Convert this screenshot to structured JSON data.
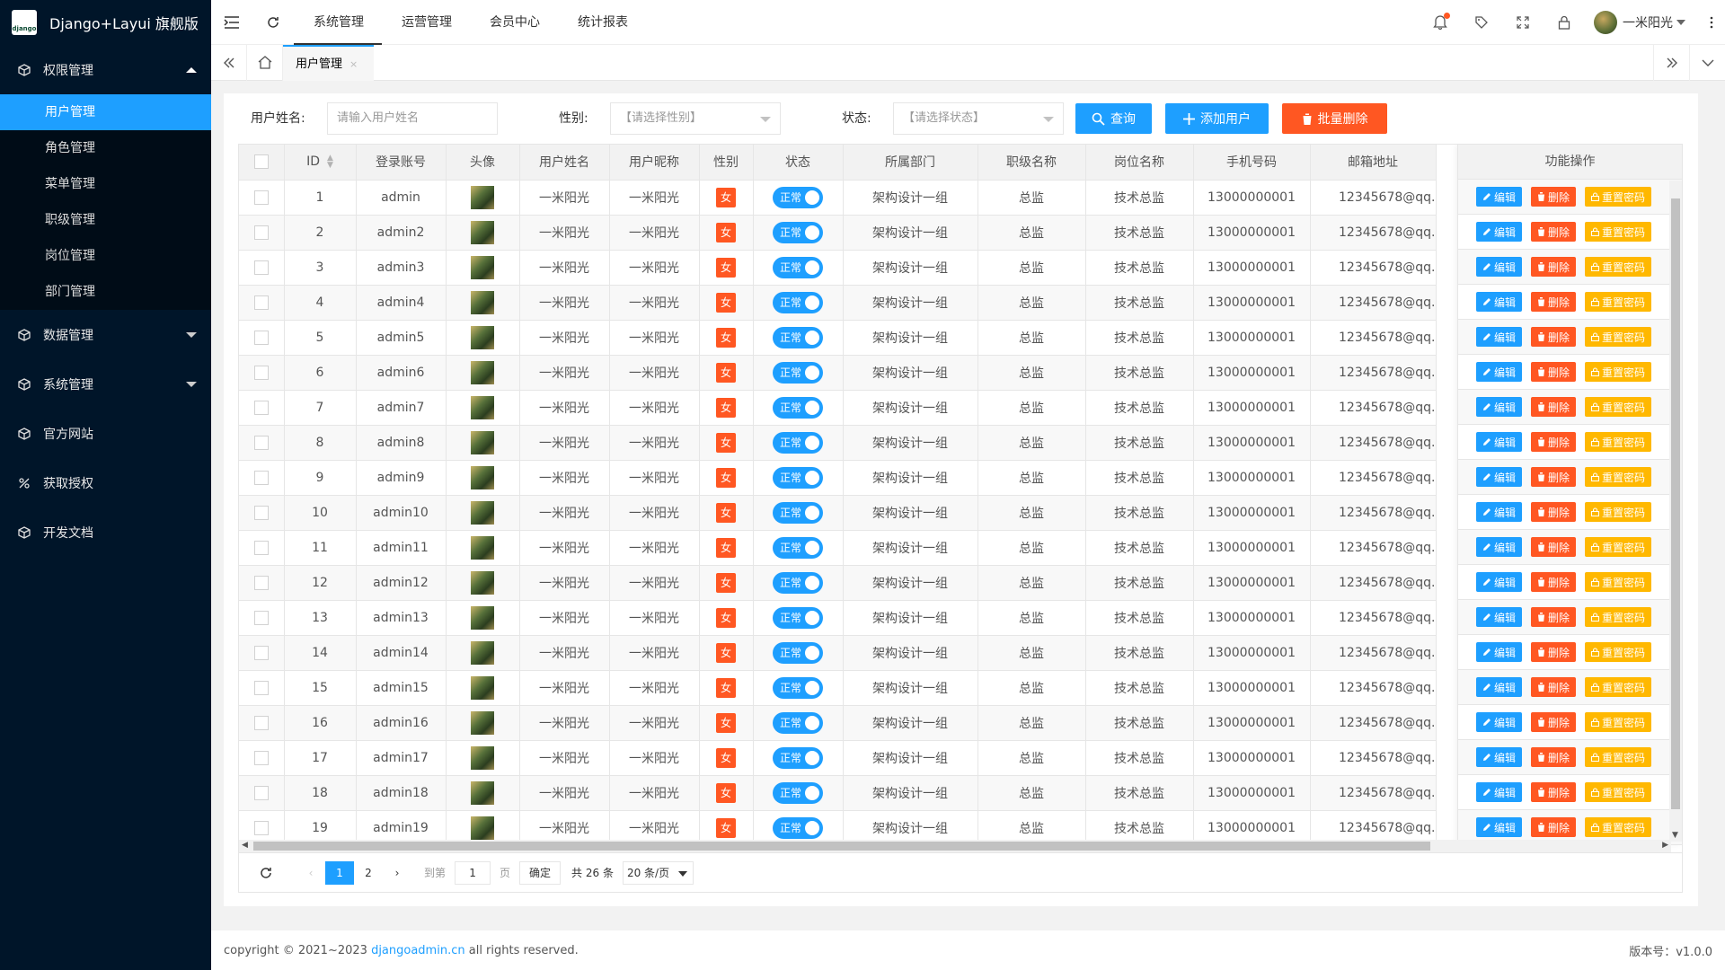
{
  "app": {
    "title": "Django+Layui 旗舰版",
    "logo_text": "django"
  },
  "sidebar": {
    "groups": [
      {
        "label": "权限管理",
        "icon": "cube-icon",
        "expanded": true,
        "items": [
          "用户管理",
          "角色管理",
          "菜单管理",
          "职级管理",
          "岗位管理",
          "部门管理"
        ]
      },
      {
        "label": "数据管理",
        "icon": "cube-icon",
        "expanded": false
      },
      {
        "label": "系统管理",
        "icon": "cube-icon",
        "expanded": false
      },
      {
        "label": "官方网站",
        "icon": "cube-icon"
      },
      {
        "label": "获取授权",
        "icon": "percent-icon"
      },
      {
        "label": "开发文档",
        "icon": "cube-icon"
      }
    ],
    "active_item": "用户管理"
  },
  "header": {
    "menus": [
      "系统管理",
      "运营管理",
      "会员中心",
      "统计报表"
    ],
    "active_menu": "系统管理",
    "user_name": "一米阳光"
  },
  "tabs": {
    "current": "用户管理",
    "close": "×"
  },
  "search": {
    "name_label": "用户姓名:",
    "name_placeholder": "请输入用户姓名",
    "gender_label": "性别:",
    "gender_placeholder": "【请选择性别】",
    "status_label": "状态:",
    "status_placeholder": "【请选择状态】",
    "query_btn": "查询",
    "add_btn": "添加用户",
    "batch_delete_btn": "批量删除"
  },
  "table": {
    "headers": [
      "ID",
      "登录账号",
      "头像",
      "用户姓名",
      "用户昵称",
      "性别",
      "状态",
      "所属部门",
      "职级名称",
      "岗位名称",
      "手机号码",
      "邮箱地址"
    ],
    "ops_header": "功能操作",
    "ops": {
      "edit": "编辑",
      "delete": "删除",
      "reset": "重置密码"
    },
    "rows": [
      {
        "id": "1",
        "account": "admin",
        "realname": "一米阳光",
        "nickname": "一米阳光",
        "gender": "女",
        "status": "正常",
        "dept": "架构设计一组",
        "level": "总监",
        "post": "技术总监",
        "mobile": "13000000001",
        "email": "12345678@qq."
      },
      {
        "id": "2",
        "account": "admin2",
        "realname": "一米阳光",
        "nickname": "一米阳光",
        "gender": "女",
        "status": "正常",
        "dept": "架构设计一组",
        "level": "总监",
        "post": "技术总监",
        "mobile": "13000000001",
        "email": "12345678@qq."
      },
      {
        "id": "3",
        "account": "admin3",
        "realname": "一米阳光",
        "nickname": "一米阳光",
        "gender": "女",
        "status": "正常",
        "dept": "架构设计一组",
        "level": "总监",
        "post": "技术总监",
        "mobile": "13000000001",
        "email": "12345678@qq."
      },
      {
        "id": "4",
        "account": "admin4",
        "realname": "一米阳光",
        "nickname": "一米阳光",
        "gender": "女",
        "status": "正常",
        "dept": "架构设计一组",
        "level": "总监",
        "post": "技术总监",
        "mobile": "13000000001",
        "email": "12345678@qq."
      },
      {
        "id": "5",
        "account": "admin5",
        "realname": "一米阳光",
        "nickname": "一米阳光",
        "gender": "女",
        "status": "正常",
        "dept": "架构设计一组",
        "level": "总监",
        "post": "技术总监",
        "mobile": "13000000001",
        "email": "12345678@qq."
      },
      {
        "id": "6",
        "account": "admin6",
        "realname": "一米阳光",
        "nickname": "一米阳光",
        "gender": "女",
        "status": "正常",
        "dept": "架构设计一组",
        "level": "总监",
        "post": "技术总监",
        "mobile": "13000000001",
        "email": "12345678@qq."
      },
      {
        "id": "7",
        "account": "admin7",
        "realname": "一米阳光",
        "nickname": "一米阳光",
        "gender": "女",
        "status": "正常",
        "dept": "架构设计一组",
        "level": "总监",
        "post": "技术总监",
        "mobile": "13000000001",
        "email": "12345678@qq."
      },
      {
        "id": "8",
        "account": "admin8",
        "realname": "一米阳光",
        "nickname": "一米阳光",
        "gender": "女",
        "status": "正常",
        "dept": "架构设计一组",
        "level": "总监",
        "post": "技术总监",
        "mobile": "13000000001",
        "email": "12345678@qq."
      },
      {
        "id": "9",
        "account": "admin9",
        "realname": "一米阳光",
        "nickname": "一米阳光",
        "gender": "女",
        "status": "正常",
        "dept": "架构设计一组",
        "level": "总监",
        "post": "技术总监",
        "mobile": "13000000001",
        "email": "12345678@qq."
      },
      {
        "id": "10",
        "account": "admin10",
        "realname": "一米阳光",
        "nickname": "一米阳光",
        "gender": "女",
        "status": "正常",
        "dept": "架构设计一组",
        "level": "总监",
        "post": "技术总监",
        "mobile": "13000000001",
        "email": "12345678@qq."
      },
      {
        "id": "11",
        "account": "admin11",
        "realname": "一米阳光",
        "nickname": "一米阳光",
        "gender": "女",
        "status": "正常",
        "dept": "架构设计一组",
        "level": "总监",
        "post": "技术总监",
        "mobile": "13000000001",
        "email": "12345678@qq."
      },
      {
        "id": "12",
        "account": "admin12",
        "realname": "一米阳光",
        "nickname": "一米阳光",
        "gender": "女",
        "status": "正常",
        "dept": "架构设计一组",
        "level": "总监",
        "post": "技术总监",
        "mobile": "13000000001",
        "email": "12345678@qq."
      },
      {
        "id": "13",
        "account": "admin13",
        "realname": "一米阳光",
        "nickname": "一米阳光",
        "gender": "女",
        "status": "正常",
        "dept": "架构设计一组",
        "level": "总监",
        "post": "技术总监",
        "mobile": "13000000001",
        "email": "12345678@qq."
      },
      {
        "id": "14",
        "account": "admin14",
        "realname": "一米阳光",
        "nickname": "一米阳光",
        "gender": "女",
        "status": "正常",
        "dept": "架构设计一组",
        "level": "总监",
        "post": "技术总监",
        "mobile": "13000000001",
        "email": "12345678@qq."
      },
      {
        "id": "15",
        "account": "admin15",
        "realname": "一米阳光",
        "nickname": "一米阳光",
        "gender": "女",
        "status": "正常",
        "dept": "架构设计一组",
        "level": "总监",
        "post": "技术总监",
        "mobile": "13000000001",
        "email": "12345678@qq."
      },
      {
        "id": "16",
        "account": "admin16",
        "realname": "一米阳光",
        "nickname": "一米阳光",
        "gender": "女",
        "status": "正常",
        "dept": "架构设计一组",
        "level": "总监",
        "post": "技术总监",
        "mobile": "13000000001",
        "email": "12345678@qq."
      },
      {
        "id": "17",
        "account": "admin17",
        "realname": "一米阳光",
        "nickname": "一米阳光",
        "gender": "女",
        "status": "正常",
        "dept": "架构设计一组",
        "level": "总监",
        "post": "技术总监",
        "mobile": "13000000001",
        "email": "12345678@qq."
      },
      {
        "id": "18",
        "account": "admin18",
        "realname": "一米阳光",
        "nickname": "一米阳光",
        "gender": "女",
        "status": "正常",
        "dept": "架构设计一组",
        "level": "总监",
        "post": "技术总监",
        "mobile": "13000000001",
        "email": "12345678@qq."
      },
      {
        "id": "19",
        "account": "admin19",
        "realname": "一米阳光",
        "nickname": "一米阳光",
        "gender": "女",
        "status": "正常",
        "dept": "架构设计一组",
        "level": "总监",
        "post": "技术总监",
        "mobile": "13000000001",
        "email": "12345678@qq."
      }
    ]
  },
  "pager": {
    "pages": [
      "1",
      "2"
    ],
    "current": "1",
    "goto_label": "到第",
    "goto_value": "1",
    "page_unit": "页",
    "confirm": "确定",
    "total": "共 26 条",
    "page_size": "20 条/页"
  },
  "footer": {
    "copy_prefix": "copyright © 2021~2023",
    "link": "djangoadmin.cn",
    "copy_suffix": "all rights reserved.",
    "version": "版本号：v1.0.0"
  },
  "colors": {
    "primary": "#1e9fff",
    "danger": "#ff5722",
    "warn": "#ffb800",
    "sidebar": "#001529"
  }
}
